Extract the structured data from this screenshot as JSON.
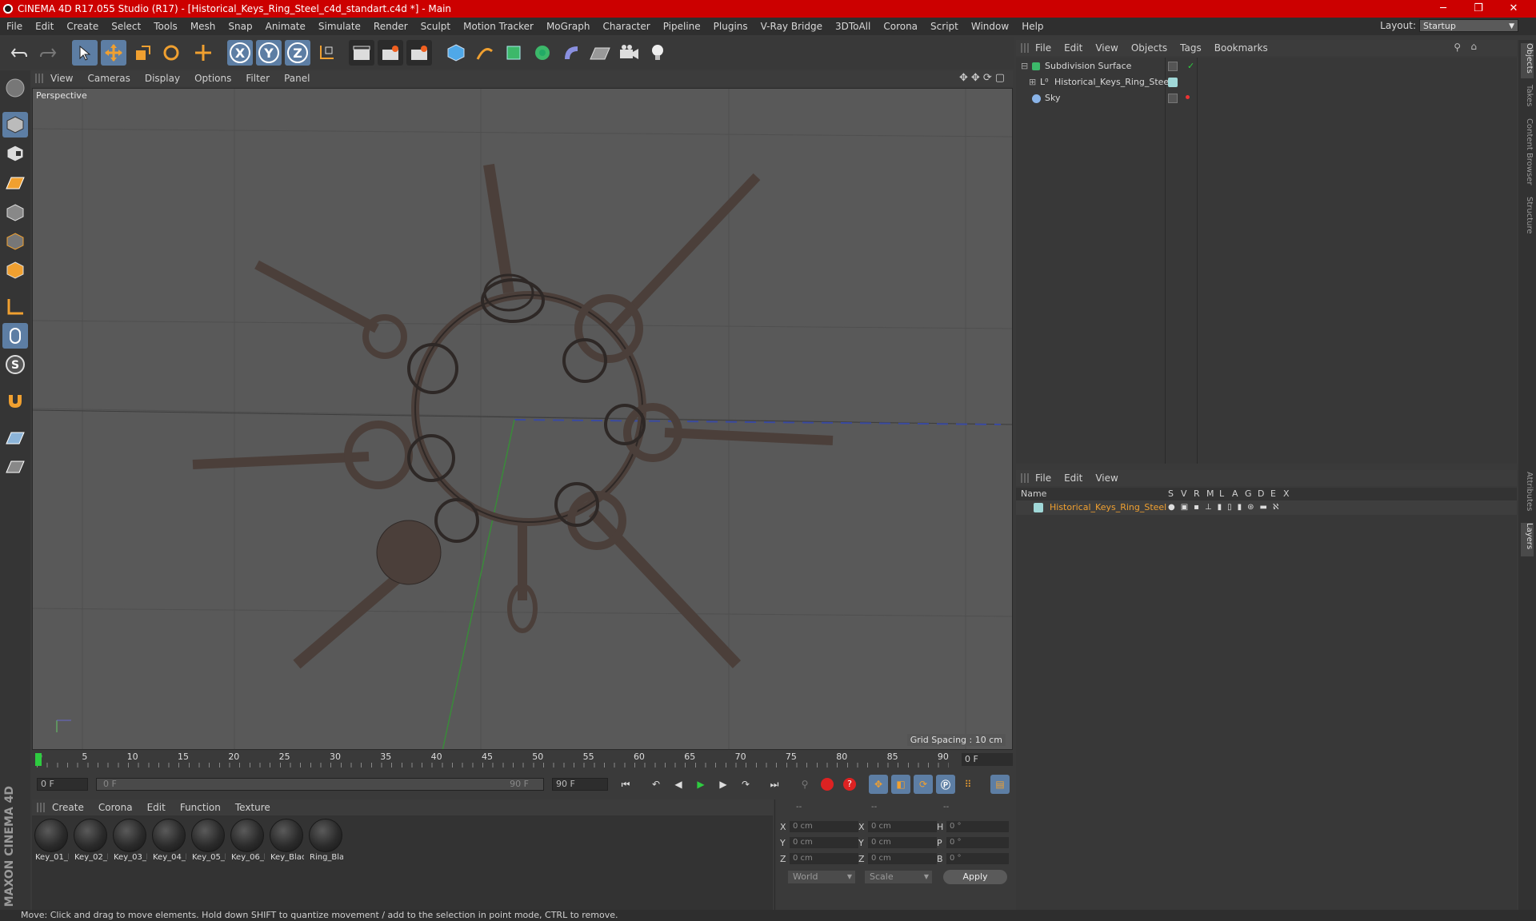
{
  "window": {
    "title": "CINEMA 4D R17.055 Studio (R17) - [Historical_Keys_Ring_Steel_c4d_standart.c4d *] - Main",
    "minimize": "─",
    "maximize": "❐",
    "close": "✕"
  },
  "menubar": {
    "items": [
      "File",
      "Edit",
      "Create",
      "Select",
      "Tools",
      "Mesh",
      "Snap",
      "Animate",
      "Simulate",
      "Render",
      "Sculpt",
      "Motion Tracker",
      "MoGraph",
      "Character",
      "Pipeline",
      "Plugins",
      "V-Ray Bridge",
      "3DToAll",
      "Corona",
      "Script",
      "Window",
      "Help"
    ],
    "layout_label": "Layout:",
    "layout_value": "Startup"
  },
  "toolbar": {
    "axis_x": "X",
    "axis_y": "Y",
    "axis_z": "Z"
  },
  "viewport": {
    "menu": [
      "View",
      "Cameras",
      "Display",
      "Options",
      "Filter",
      "Panel"
    ],
    "label": "Perspective",
    "grid_spacing": "Grid Spacing : 10 cm"
  },
  "timeline": {
    "ticks": [
      "0",
      "5",
      "10",
      "15",
      "20",
      "25",
      "30",
      "35",
      "40",
      "45",
      "50",
      "55",
      "60",
      "65",
      "70",
      "75",
      "80",
      "85",
      "90"
    ],
    "current_frame": "0 F"
  },
  "transport": {
    "start_field": "0 F",
    "range_start": "0 F",
    "range_end": "90 F",
    "end_field": "90 F"
  },
  "materials": {
    "menu": [
      "Create",
      "Corona",
      "Edit",
      "Function",
      "Texture"
    ],
    "items": [
      "Key_01_l",
      "Key_02_l",
      "Key_03_l",
      "Key_04_l",
      "Key_05_l",
      "Key_06_l",
      "Key_Blac",
      "Ring_Bla"
    ]
  },
  "coordinates": {
    "head": [
      "--",
      "--",
      "--"
    ],
    "rows": [
      {
        "a": "X",
        "av": "0 cm",
        "b": "X",
        "bv": "0 cm",
        "c": "H",
        "cv": "0 °"
      },
      {
        "a": "Y",
        "av": "0 cm",
        "b": "Y",
        "bv": "0 cm",
        "c": "P",
        "cv": "0 °"
      },
      {
        "a": "Z",
        "av": "0 cm",
        "b": "Z",
        "bv": "0 cm",
        "c": "B",
        "cv": "0 °"
      }
    ],
    "world": "World",
    "scale": "Scale",
    "apply": "Apply"
  },
  "objects": {
    "menu": [
      "File",
      "Edit",
      "View",
      "Objects",
      "Tags",
      "Bookmarks"
    ],
    "items": [
      {
        "name": "Subdivision Surface"
      },
      {
        "name": "Historical_Keys_Ring_Steel"
      },
      {
        "name": "Sky"
      }
    ]
  },
  "layers": {
    "menu": [
      "File",
      "Edit",
      "View"
    ],
    "columns": {
      "name": "Name",
      "flags": [
        "S",
        "V",
        "R",
        "M",
        "L",
        "A",
        "G",
        "D",
        "E",
        "X"
      ]
    },
    "items": [
      {
        "name": "Historical_Keys_Ring_Steel",
        "color": "#f0a030"
      }
    ]
  },
  "right_tabs": [
    "Objects",
    "Takes",
    "Content Browser",
    "Structure",
    "Attributes",
    "Layers"
  ],
  "brand": "MAXON CINEMA 4D",
  "status": "Move: Click and drag to move elements. Hold down SHIFT to quantize movement / add to the selection in point mode, CTRL to remove."
}
